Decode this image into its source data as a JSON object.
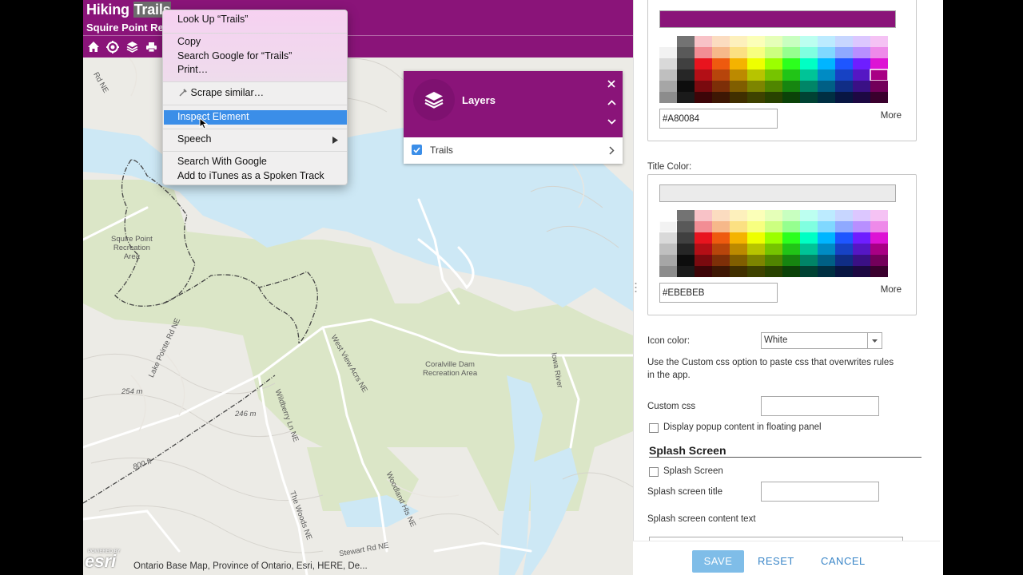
{
  "app": {
    "title_prefix": "Hiking ",
    "title_highlight": "Trails",
    "subtitle": "Squire Point Re",
    "tools": [
      "home-icon",
      "locate-icon",
      "layers-icon",
      "print-icon"
    ]
  },
  "layers_panel": {
    "title": "Layers",
    "items": [
      {
        "label": "Trails",
        "checked": true
      }
    ]
  },
  "map": {
    "labels": {
      "road1": "Rd NE",
      "squire": "Squire Point\nRecreation\nArea",
      "coralville": "Coralville Dam\nRecreation Area",
      "lake_pointe": "Lake Pointe Rd NE",
      "west_view": "West View Acrs NE",
      "wildberry": "Wildberry Ln NE",
      "woodland": "Woodland Hls NE",
      "the_woods": "The Woods NE",
      "stewart": "Stewart Rd NE",
      "iowa_river": "Iowa River",
      "elev_254": "254 m",
      "elev_246": "246 m",
      "elev_800": "800 ft"
    },
    "logo": "esri",
    "powered_by": "POWERED BY",
    "attribution": "Ontario Base Map, Province of Ontario, Esri, HERE, De..."
  },
  "context_menu": {
    "items": [
      "Look Up “Trails”",
      "Copy",
      "Search Google for “Trails”",
      "Print…",
      "Scrape similar…",
      "Inspect Element",
      "Speech",
      "Search With Google",
      "Add to iTunes as a Spoken Track"
    ],
    "highlighted": "Inspect Element"
  },
  "settings": {
    "header_color": {
      "hex": "#A80084",
      "preview": "#8a1479"
    },
    "title_color_label": "Title Color:",
    "title_color": {
      "hex": "#EBEBEB",
      "preview": "#ebebeb"
    },
    "more_label": "More",
    "icon_color_label": "Icon color:",
    "icon_color_value": "White",
    "custom_css_note": "Use the Custom css option to paste css that overwrites rules in the app.",
    "custom_css_label": "Custom css",
    "floating_panel_label": "Display popup content in floating panel",
    "splash_section": "Splash Screen",
    "splash_checkbox_label": "Splash Screen",
    "splash_title_label": "Splash screen title",
    "splash_content_label": "Splash screen content text",
    "buttons": {
      "save": "SAVE",
      "reset": "RESET",
      "cancel": "CANCEL"
    }
  },
  "palette_colors": {
    "grays": [
      "#ffffff",
      "#f2f2f2",
      "#d9d9d9",
      "#bfbfbf",
      "#a6a6a6",
      "#8c8c8c"
    ],
    "darks": [
      "#737373",
      "#595959",
      "#404040",
      "#262626",
      "#0d0d0d",
      "#1a1a1a"
    ],
    "hues": [
      [
        "#f8c2c7",
        "#fbdcc0",
        "#fdf0bc",
        "#fbffb8",
        "#e5ffb8",
        "#c8ffc0",
        "#bcfff0",
        "#bcebff",
        "#c7d6ff",
        "#dcc7ff",
        "#f5c2f4"
      ],
      [
        "#f28d94",
        "#f6b88a",
        "#fbe082",
        "#f7ff80",
        "#ccff80",
        "#95ff8f",
        "#80ffe0",
        "#80d8ff",
        "#8fa9ff",
        "#b88fff",
        "#ee8ae9"
      ],
      [
        "#e8141e",
        "#ee5a0f",
        "#f4b300",
        "#eeff00",
        "#9bff00",
        "#2cff1e",
        "#00ffc4",
        "#00b5ff",
        "#1e56ff",
        "#6e1eff",
        "#dd13d4"
      ],
      [
        "#b30f16",
        "#b7450b",
        "#bc8a00",
        "#b7c400",
        "#76c400",
        "#21c417",
        "#00c497",
        "#008bc4",
        "#1742c4",
        "#5517c4",
        "#a80084"
      ],
      [
        "#7a0a0f",
        "#7d2f08",
        "#805e00",
        "#7d8500",
        "#508500",
        "#168510",
        "#008567",
        "#005f85",
        "#102d85",
        "#3a1085",
        "#73005a"
      ],
      [
        "#3d0508",
        "#3e1704",
        "#402f00",
        "#3e4200",
        "#284200",
        "#0b4208",
        "#004233",
        "#002f42",
        "#081642",
        "#1d0842",
        "#3a002d"
      ]
    ]
  }
}
